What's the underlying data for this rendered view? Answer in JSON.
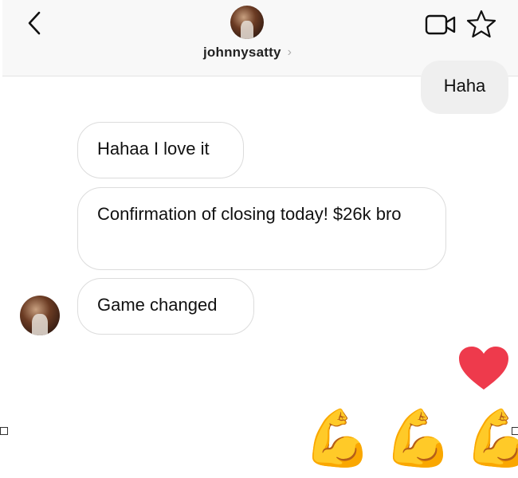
{
  "header": {
    "username": "johnnysatty",
    "chevron": "›",
    "icons": [
      "back-arrow-icon",
      "video-call-icon",
      "star-icon"
    ]
  },
  "messages": [
    {
      "direction": "outgoing",
      "text": "Haha"
    },
    {
      "direction": "incoming",
      "text": "Hahaa I love it"
    },
    {
      "direction": "incoming",
      "text": "Confirmation of closing today! $26k bro"
    },
    {
      "direction": "incoming",
      "text": "Game changed"
    }
  ],
  "reactions": {
    "heart": "heart-icon",
    "emojis": [
      "💪",
      "💪",
      "💪"
    ]
  },
  "colors": {
    "heart": "#ee3a4c",
    "header_bg": "#f8f8f8",
    "outgoing_bubble": "#efefef",
    "incoming_border": "#dcdcdc"
  }
}
